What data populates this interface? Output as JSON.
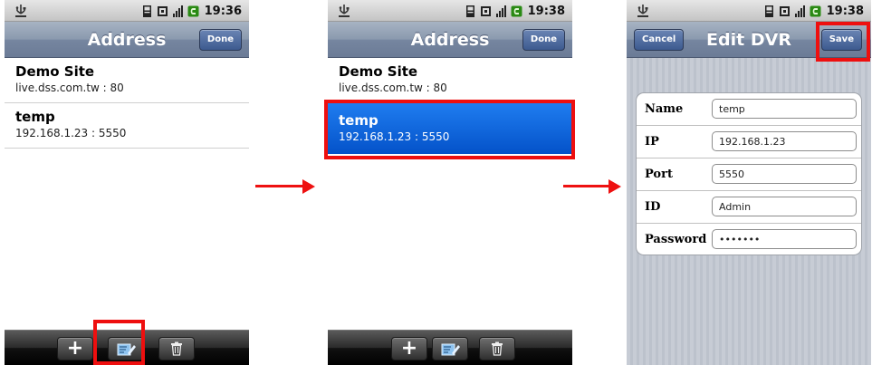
{
  "status_time_1": "19:36",
  "status_time_2": "19:38",
  "status_time_3": "19:38",
  "address": {
    "title": "Address",
    "done_label": "Done",
    "entries": [
      {
        "name": "Demo Site",
        "addr": "live.dss.com.tw : 80"
      },
      {
        "name": "temp",
        "addr": "192.168.1.23 : 5550"
      }
    ]
  },
  "toolbar": {
    "add_label": "+"
  },
  "edit": {
    "title": "Edit DVR",
    "cancel_label": "Cancel",
    "save_label": "Save",
    "fields": [
      {
        "label": "Name",
        "value": "temp"
      },
      {
        "label": "IP",
        "value": "192.168.1.23"
      },
      {
        "label": "Port",
        "value": "5550"
      },
      {
        "label": "ID",
        "value": "Admin"
      },
      {
        "label": "Password",
        "value": "•••••••"
      }
    ]
  },
  "colors": {
    "highlight": "#ee0f0f",
    "selected_row": "#0a63dd",
    "nav_button": "#4b68a0"
  },
  "icons": [
    "usb-icon",
    "sd-card-icon",
    "signal-icon",
    "battery-icon",
    "add-icon",
    "edit-icon",
    "trash-icon",
    "arrow-right-icon"
  ]
}
